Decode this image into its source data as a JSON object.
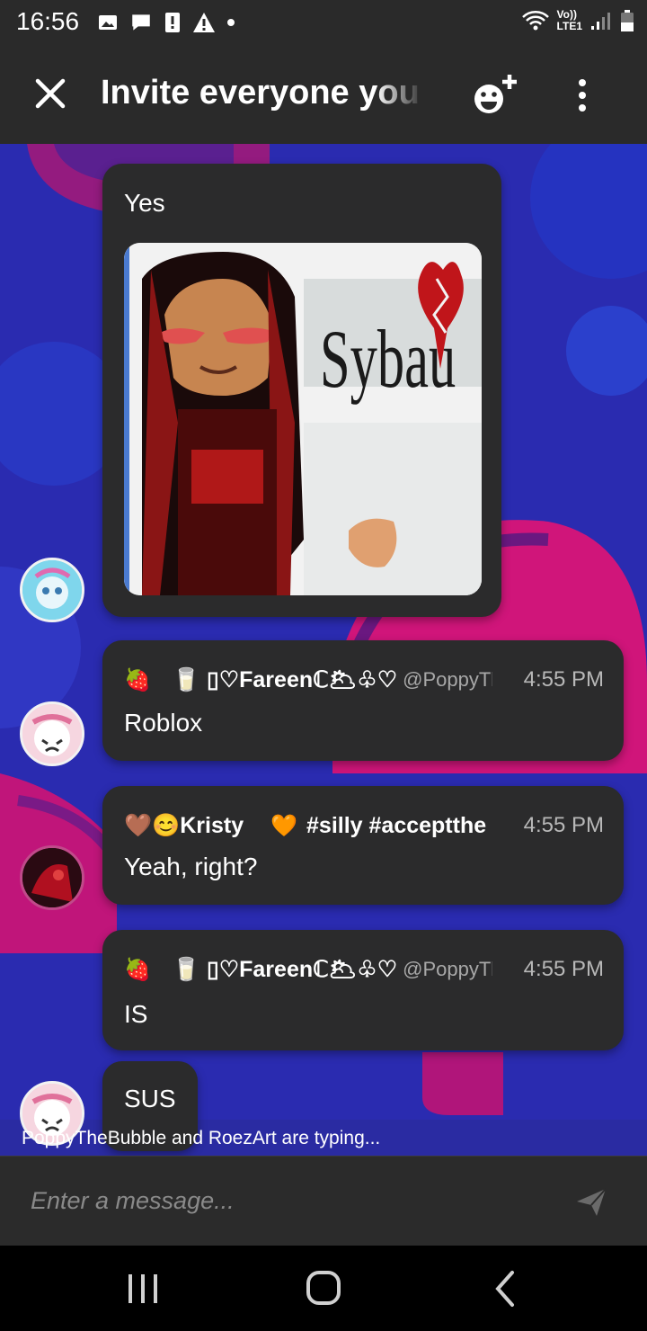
{
  "status_bar": {
    "time": "16:56",
    "network_top": "Vo))",
    "network_bottom": "LTE1"
  },
  "header": {
    "title": "Invite everyone you",
    "close_icon": "close-icon",
    "add_emoji_icon": "add-emoji-icon",
    "more_icon": "more-vertical-icon"
  },
  "messages": [
    {
      "text": "Yes",
      "has_image": true,
      "image_caption": "Sybau"
    },
    {
      "author_prefix": "🍓",
      "author": "🥛 ▯♡Fareenℂ🌥♧♡",
      "handle": "@PoppyTh",
      "time": "4:55 PM",
      "text": "Roblox"
    },
    {
      "author": "🤎😊Kristy",
      "tag_emoji": "🧡",
      "handle": "#silly #acceptthe",
      "time": "4:55 PM",
      "text": "Yeah, right?"
    },
    {
      "author_prefix": "🍓",
      "author": "🥛 ▯♡Fareenℂ🌥♧♡",
      "handle": "@PoppyTh",
      "time": "4:55 PM",
      "text": "IS"
    },
    {
      "text": "SUS"
    }
  ],
  "typing_indicator": "PoppyTheBubble and RoezArt are typing...",
  "composer": {
    "placeholder": "Enter a message..."
  },
  "colors": {
    "chat_bg": "#2a2bb0",
    "bubble": "#2b2b2c",
    "bar": "#2a2a2a",
    "accent_pink": "#d0157a"
  }
}
